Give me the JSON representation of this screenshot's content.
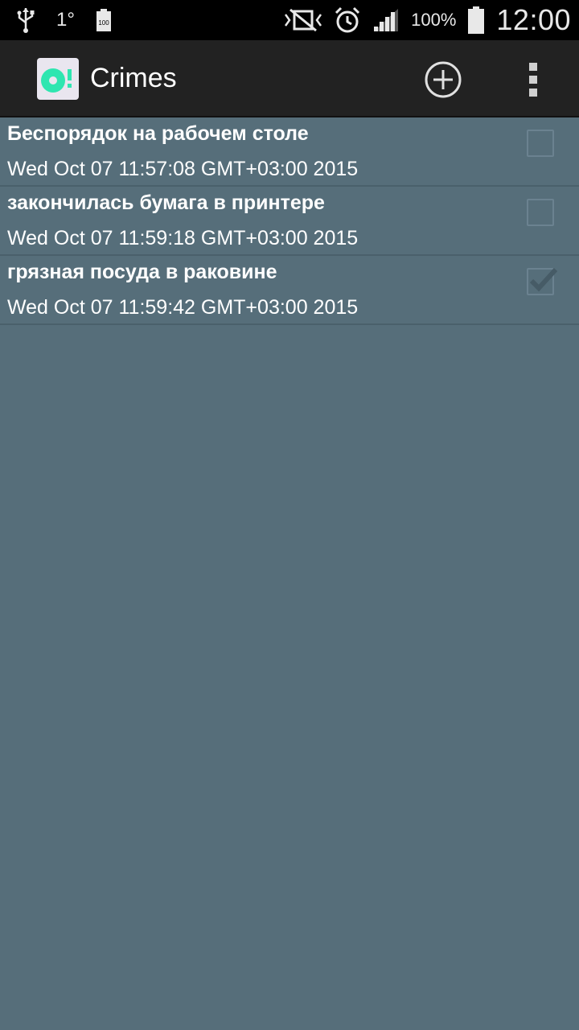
{
  "status_bar": {
    "usb_icon": "usb-icon",
    "temperature": "1°",
    "battery_badge": "100",
    "battery_percent": "100%",
    "time": "12:00"
  },
  "action_bar": {
    "title": "Crimes",
    "add_icon": "add-circle-icon",
    "overflow_icon": "overflow-menu-icon"
  },
  "crimes": [
    {
      "title": "Беспорядок на рабочем столе",
      "date": "Wed Oct 07 11:57:08 GMT+03:00 2015",
      "solved": false
    },
    {
      "title": "закончилась бумага в принтере",
      "date": "Wed Oct 07 11:59:18 GMT+03:00 2015",
      "solved": false
    },
    {
      "title": "грязная посуда в раковине",
      "date": "Wed Oct 07 11:59:42 GMT+03:00 2015",
      "solved": true
    }
  ],
  "colors": {
    "background": "#566e7a",
    "action_bar": "#222222",
    "status_bar": "#000000",
    "app_icon_accent": "#2ee6b0"
  }
}
